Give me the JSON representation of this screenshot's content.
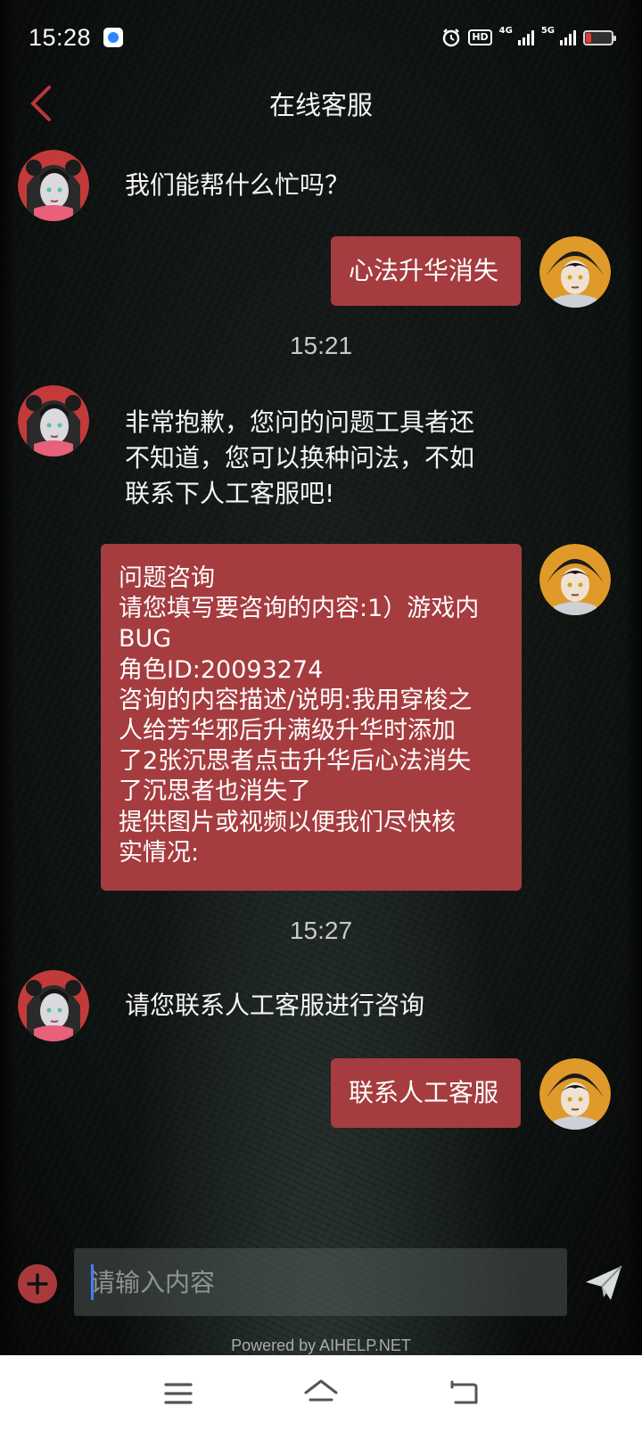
{
  "status_bar": {
    "time": "15:28",
    "hd_label": "HD",
    "net1_label": "4G",
    "net2_label": "5G",
    "battery_color": "#e53935"
  },
  "header": {
    "title": "在线客服",
    "back_icon": "chevron-left-icon"
  },
  "messages": {
    "m1_bot": "我们能帮什么忙吗？",
    "m2_user": "心法升华消失",
    "time1": "15:21",
    "m3_bot_lines": [
      "非常抱歉，您问的问题工具者还",
      "不知道，您可以换种问法，不如",
      "联系下人工客服吧!"
    ],
    "m4_user_lines": [
      "问题咨询",
      "请您填写要咨询的内容:1）游戏内",
      "BUG",
      "角色ID:20093274",
      "咨询的内容描述/说明:我用穿梭之",
      "人给芳华邪后升满级升华时添加",
      "了2张沉思者点击升华后心法消失",
      "了沉思者也消失了",
      "提供图片或视频以便我们尽快核",
      "实情况:"
    ],
    "time2": "15:27",
    "m5_bot": "请您联系人工客服进行咨询",
    "m6_user": "联系人工客服"
  },
  "input": {
    "placeholder": "请输入内容",
    "value": "",
    "plus_icon": "plus-icon",
    "send_icon": "send-icon"
  },
  "footer": {
    "powered_by": "Powered by AIHELP.NET"
  },
  "nav": {
    "menu_icon": "menu-icon",
    "home_icon": "home-icon",
    "back_icon": "back-icon"
  },
  "colors": {
    "accent": "#a53c3f",
    "background": "#0d1110",
    "text": "#f5f5f5"
  }
}
